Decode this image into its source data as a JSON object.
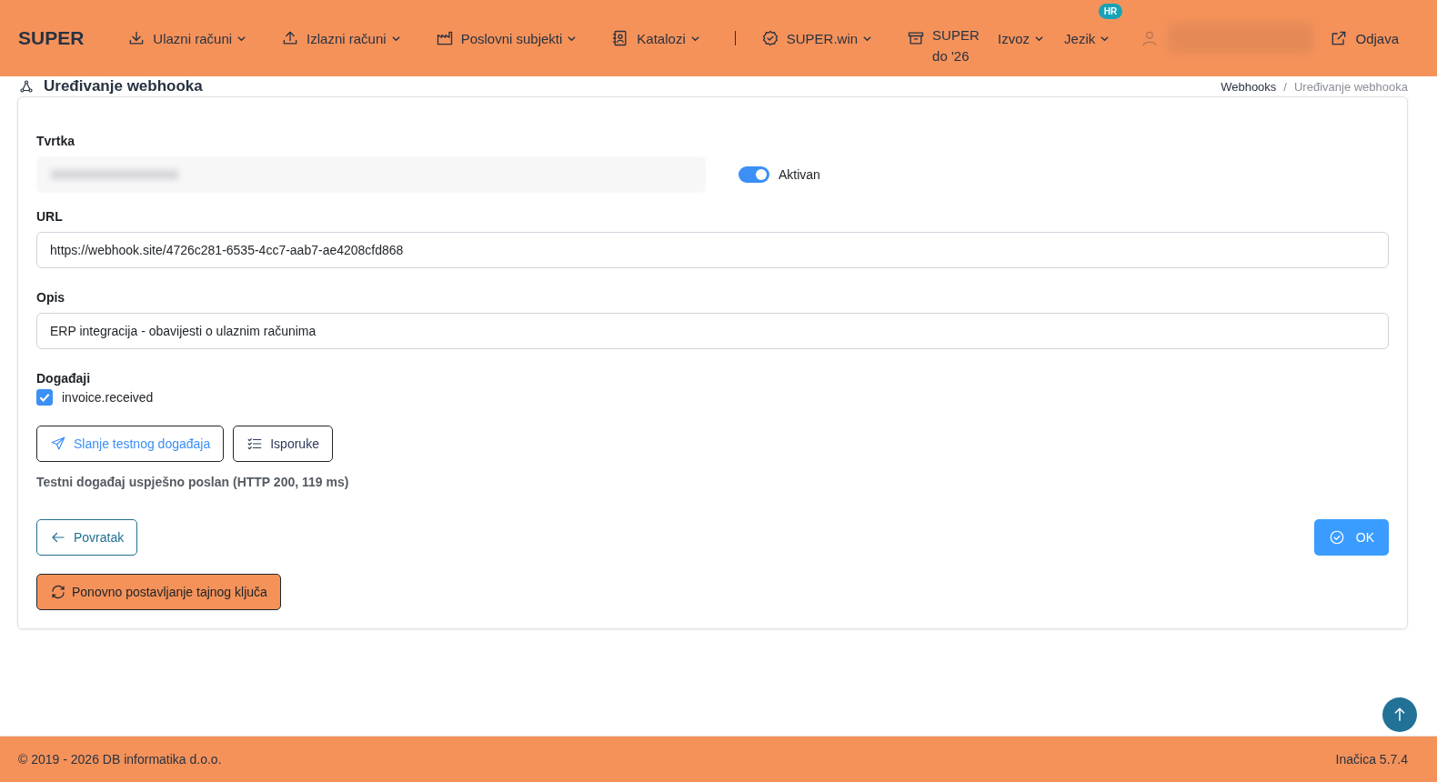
{
  "header": {
    "brand": "SUPER",
    "nav": [
      {
        "label": "Ulazni računi",
        "dropdown": true
      },
      {
        "label": "Izlazni računi",
        "dropdown": true
      },
      {
        "label": "Poslovni subjekti",
        "dropdown": true
      },
      {
        "label": "Katalozi",
        "dropdown": true
      },
      {
        "label": "SUPER.win",
        "dropdown": true
      },
      {
        "label": "SUPER do '26",
        "dropdown": false
      },
      {
        "label": "Izvoz",
        "dropdown": true
      },
      {
        "label": "Jezik",
        "dropdown": true,
        "badge": "HR"
      }
    ],
    "logout": "Odjava"
  },
  "page": {
    "title": "Uređivanje webhooka",
    "breadcrumb": [
      "Webhooks",
      "Uređivanje webhooka"
    ],
    "breadcrumb_separator": "/"
  },
  "form": {
    "company_label": "Tvrtka",
    "active": {
      "label": "Aktivan",
      "on": true
    },
    "url_label": "URL",
    "url": "https://webhook.site/4726c281-6535-4cc7-aab7-ae4208cfd868",
    "description_label": "Opis",
    "description": "ERP integracija - obavijesti o ulaznim računima",
    "events_label": "Događaji",
    "events": [
      {
        "label": "invoice.received",
        "checked": true
      }
    ],
    "test_button": "Slanje testnog događaja",
    "deliveries_button": "Isporuke",
    "status_message": "Testni događaj uspješno poslan (HTTP 200, 119 ms)",
    "back_button": "Povratak",
    "ok_button": "OK",
    "reset_secret_button": "Ponovno postavljanje tajnog ključa"
  },
  "footer": {
    "copyright": "© 2019 - 2026 DB informatika d.o.o.",
    "version": "Inačica 5.7.4"
  }
}
